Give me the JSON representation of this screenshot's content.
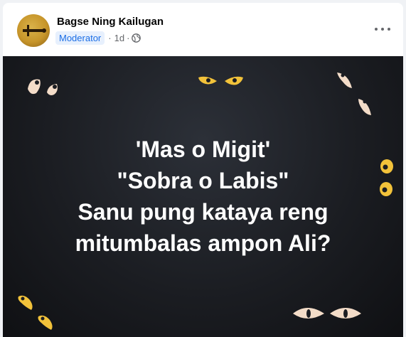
{
  "post": {
    "author": "Bagse Ning Kailugan",
    "badge": "Moderator",
    "separator": "·",
    "time": "1d",
    "time_separator": "·",
    "privacy_icon": "globe-icon",
    "more_icon": "more-options-icon"
  },
  "image": {
    "lines": [
      "'Mas o Migit'",
      "\"Sobra o Labis\"",
      "Sanu pung kataya reng",
      "mitumbalas ampon Ali?"
    ],
    "background_color": "#1b1d22",
    "eye_color_white": "#f3dcc8",
    "eye_color_yellow": "#f2c23a"
  }
}
